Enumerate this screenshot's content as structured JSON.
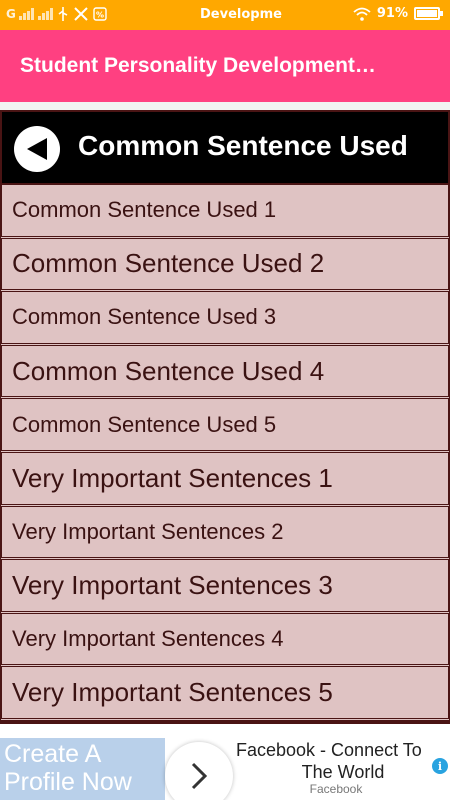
{
  "status_bar": {
    "carrier": "G",
    "center_text": "Developme",
    "battery": "91%",
    "icons": [
      "signal-icon",
      "usb-icon",
      "tools-icon",
      "percent-icon",
      "wifi-icon",
      "battery-icon"
    ]
  },
  "app_bar": {
    "title": "Student Personality Development…",
    "color": "#ff4081"
  },
  "header": {
    "title": "Common Sentence Used",
    "back_icon": "back-arrow-icon"
  },
  "list": {
    "items": [
      {
        "label": "Common Sentence Used 1"
      },
      {
        "label": "Common Sentence Used 2"
      },
      {
        "label": "Common Sentence Used 3"
      },
      {
        "label": "Common Sentence Used 4"
      },
      {
        "label": "Common Sentence Used 5"
      },
      {
        "label": "Very Important Sentences 1"
      },
      {
        "label": "Very Important Sentences 2"
      },
      {
        "label": "Very Important Sentences 3"
      },
      {
        "label": "Very Important Sentences 4"
      },
      {
        "label": "Very Important Sentences 5"
      }
    ],
    "row_color": "#dfc3c3",
    "text_color": "#3a1212"
  },
  "ad": {
    "left_line1": "Create A",
    "left_line2": "Profile Now",
    "title_line1": "Facebook - Connect To",
    "title_line2": "The World",
    "sponsor": "Facebook",
    "info_icon": "info-icon",
    "arrow_icon": "chevron-right-icon"
  }
}
